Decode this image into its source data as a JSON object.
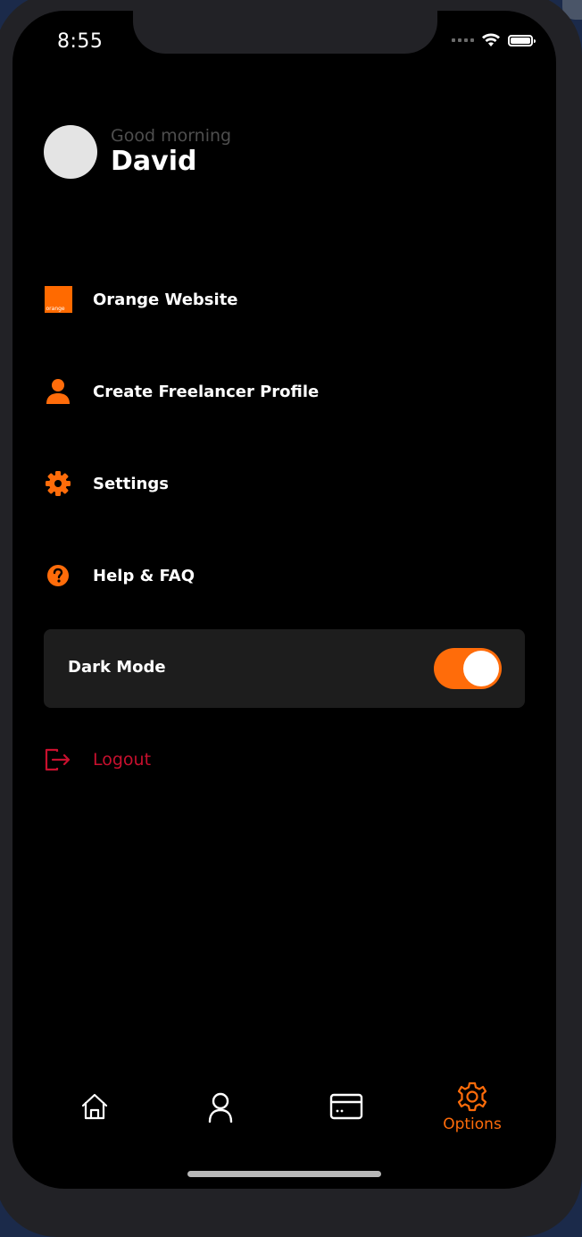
{
  "status_bar": {
    "time": "8:55"
  },
  "profile": {
    "greeting": "Good morning",
    "name": "David"
  },
  "menu": {
    "items": [
      {
        "label": "Orange Website",
        "icon": "orange-logo",
        "logo_text": "orange"
      },
      {
        "label": "Create Freelancer Profile",
        "icon": "person-icon"
      },
      {
        "label": "Settings",
        "icon": "gear-icon"
      },
      {
        "label": "Help & FAQ",
        "icon": "help-circle-icon"
      }
    ]
  },
  "dark_mode": {
    "label": "Dark Mode",
    "enabled": true
  },
  "logout": {
    "label": "Logout",
    "icon": "logout-icon"
  },
  "tabbar": {
    "tabs": [
      {
        "icon": "home-icon",
        "label": "",
        "active": false
      },
      {
        "icon": "user-icon",
        "label": "",
        "active": false
      },
      {
        "icon": "card-icon",
        "label": "",
        "active": false
      },
      {
        "icon": "gear-icon",
        "label": "Options",
        "active": true
      }
    ]
  },
  "colors": {
    "accent": "#ff6c0a",
    "logout": "#c8102e",
    "background": "#000000",
    "card": "#1d1d1d"
  }
}
